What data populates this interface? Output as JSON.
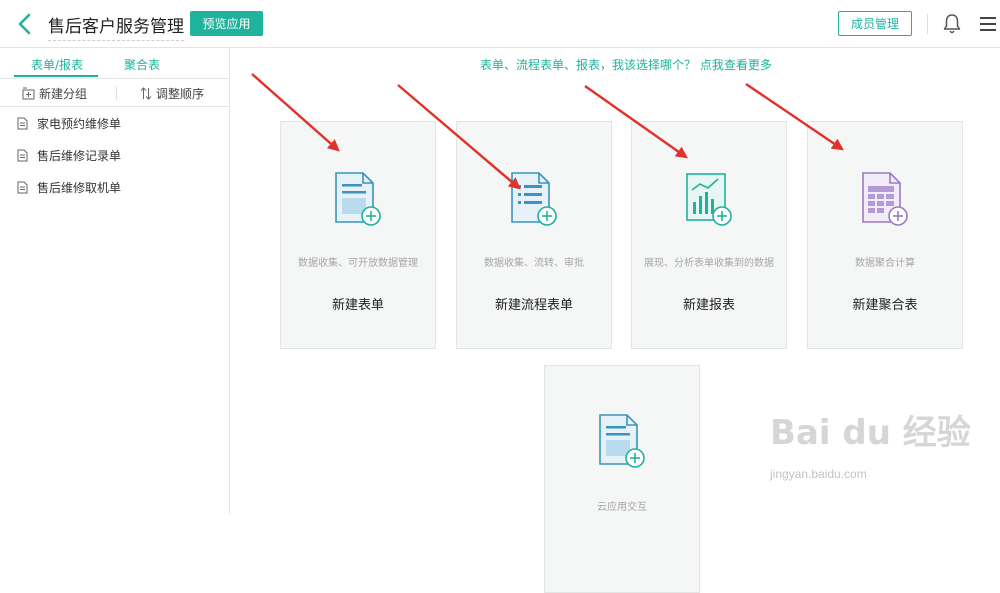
{
  "header": {
    "app_title": "售后客户服务管理",
    "preview_label": "预览应用",
    "members_label": "成员管理",
    "back_icon": "chevron-left-icon",
    "bell_icon": "bell-icon",
    "menu_icon": "hamburger-menu-icon",
    "accent_color": "#1fb29d"
  },
  "sidebar": {
    "tabs": [
      {
        "label": "表单/报表",
        "active": true
      },
      {
        "label": "聚合表",
        "active": false
      }
    ],
    "actions": {
      "new_group": "新建分组",
      "reorder": "调整顺序"
    },
    "forms": [
      {
        "label": "家电预约维修单",
        "icon": "document-icon"
      },
      {
        "label": "售后维修记录单",
        "icon": "document-icon"
      },
      {
        "label": "售后维修取机单",
        "icon": "document-icon"
      }
    ]
  },
  "main": {
    "hint": "表单、流程表单、报表，我该选择哪个？ 点我查看更多",
    "cards": [
      {
        "desc": "数据收集、可开放数据管理",
        "name": "新建表单",
        "icon": "new-form-icon"
      },
      {
        "desc": "数据收集、流转、审批",
        "name": "新建流程表单",
        "icon": "new-workflow-form-icon"
      },
      {
        "desc": "展现、分析表单收集到的数据",
        "name": "新建报表",
        "icon": "new-report-icon"
      },
      {
        "desc": "数据聚合计算",
        "name": "新建聚合表",
        "icon": "new-aggregate-table-icon"
      },
      {
        "desc": "云应用交互",
        "name": "",
        "icon": "cloud-app-icon"
      }
    ]
  },
  "watermark": {
    "logo": "Bai du 经验",
    "url": "jingyan.baidu.com"
  }
}
